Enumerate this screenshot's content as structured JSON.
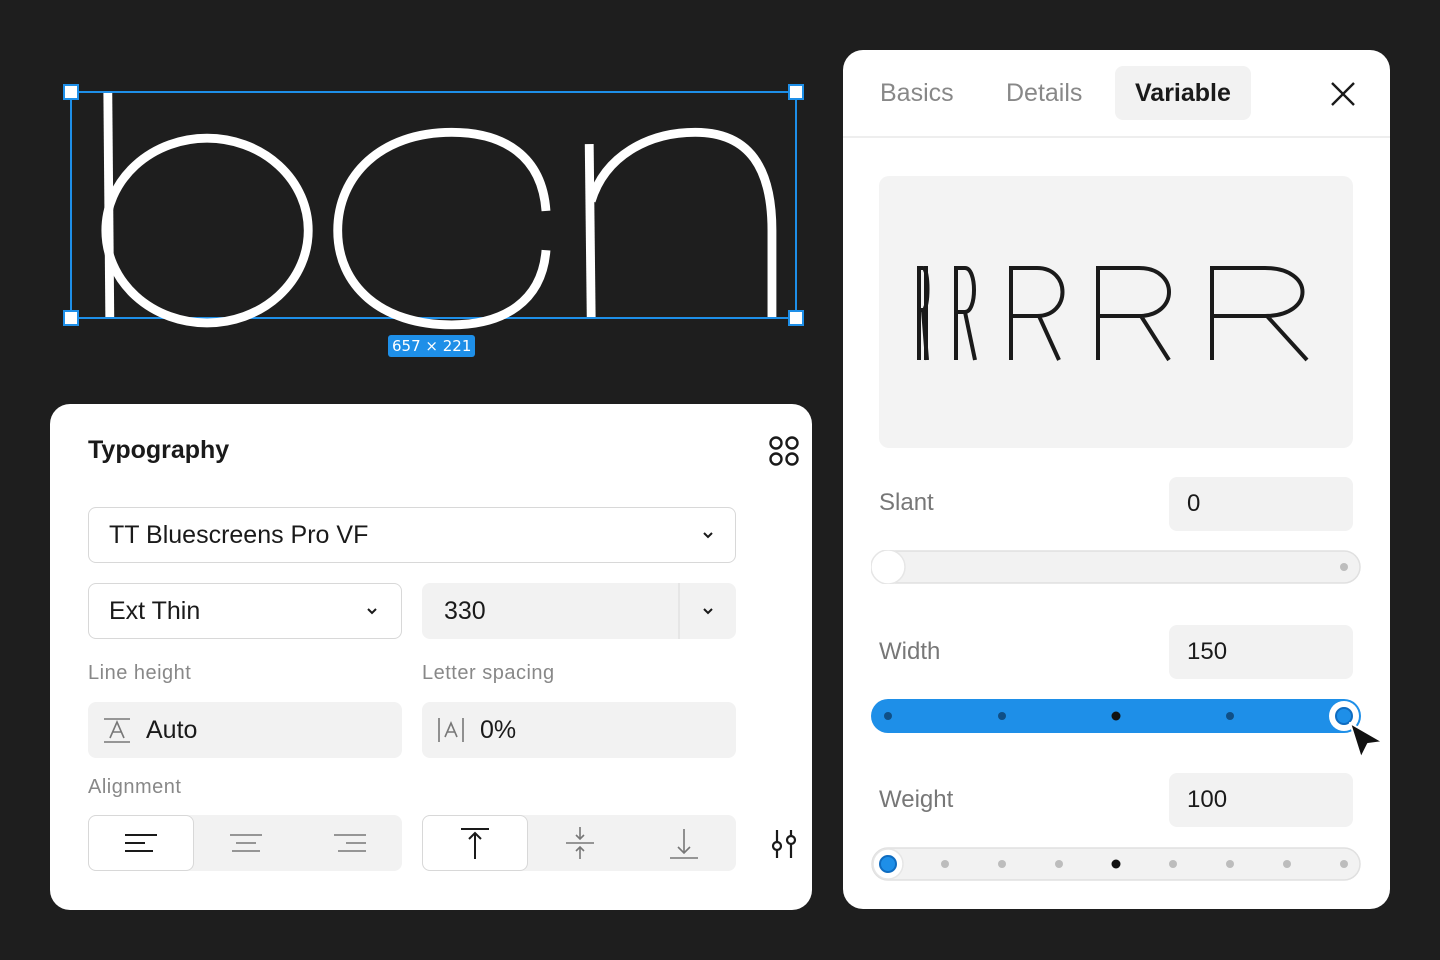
{
  "canvas": {
    "text": "bcn",
    "size_badge": "657 × 221",
    "selection_color": "#1e8fe8"
  },
  "typography": {
    "title": "Typography",
    "font_family": "TT Bluescreens Pro VF",
    "font_style": "Ext Thin",
    "font_weight": "330",
    "line_height_label": "Line height",
    "line_height_value": "Auto",
    "letter_spacing_label": "Letter spacing",
    "letter_spacing_value": "0%",
    "alignment_label": "Alignment",
    "horizontal_align": [
      "left",
      "center",
      "right"
    ],
    "horizontal_selected": "left",
    "vertical_align": [
      "top",
      "middle",
      "bottom"
    ],
    "vertical_selected": "top",
    "icons": [
      "grid-icon",
      "chevron-down-icon",
      "line-height-icon",
      "letter-spacing-icon",
      "align-left-icon",
      "align-center-icon",
      "align-right-icon",
      "align-top-icon",
      "align-middle-icon",
      "align-bottom-icon",
      "sliders-icon"
    ]
  },
  "variable_panel": {
    "tabs": [
      "Basics",
      "Details",
      "Variable"
    ],
    "active_tab": "Variable",
    "preview_glyph": "R",
    "axes": [
      {
        "label": "Slant",
        "value": "0",
        "level": 0,
        "active": false
      },
      {
        "label": "Width",
        "value": "150",
        "level": 1,
        "active": true
      },
      {
        "label": "Weight",
        "value": "100",
        "level": 0,
        "active": false
      }
    ],
    "accent_color": "#1e8fe8"
  }
}
